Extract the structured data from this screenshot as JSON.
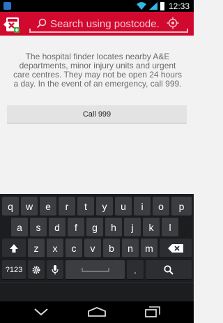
{
  "status_bar": {
    "time": "12:33"
  },
  "app_bar": {
    "search": {
      "placeholder": "Search using postcode..."
    }
  },
  "content": {
    "info_text": "The hospital finder locates nearby A&E departments, minor injury units and urgent care centres. They may not be open 24 hours a day. In the event of an emergency, call 999.",
    "call_button_label": "Call 999"
  },
  "keyboard": {
    "row1": [
      "q",
      "w",
      "e",
      "r",
      "t",
      "y",
      "u",
      "i",
      "o",
      "p"
    ],
    "row2": [
      "a",
      "s",
      "d",
      "f",
      "g",
      "h",
      "j",
      "k",
      "l"
    ],
    "row3": [
      "z",
      "x",
      "c",
      "v",
      "b",
      "n",
      "m"
    ],
    "row3_extra": [
      "!",
      "?"
    ],
    "symbols_label": "?123",
    "comma": ",",
    "period": "."
  },
  "colors": {
    "brand_red": "#d2092f",
    "keyboard_bg": "#1c1d1f",
    "key_bg": "#3b3d40"
  }
}
